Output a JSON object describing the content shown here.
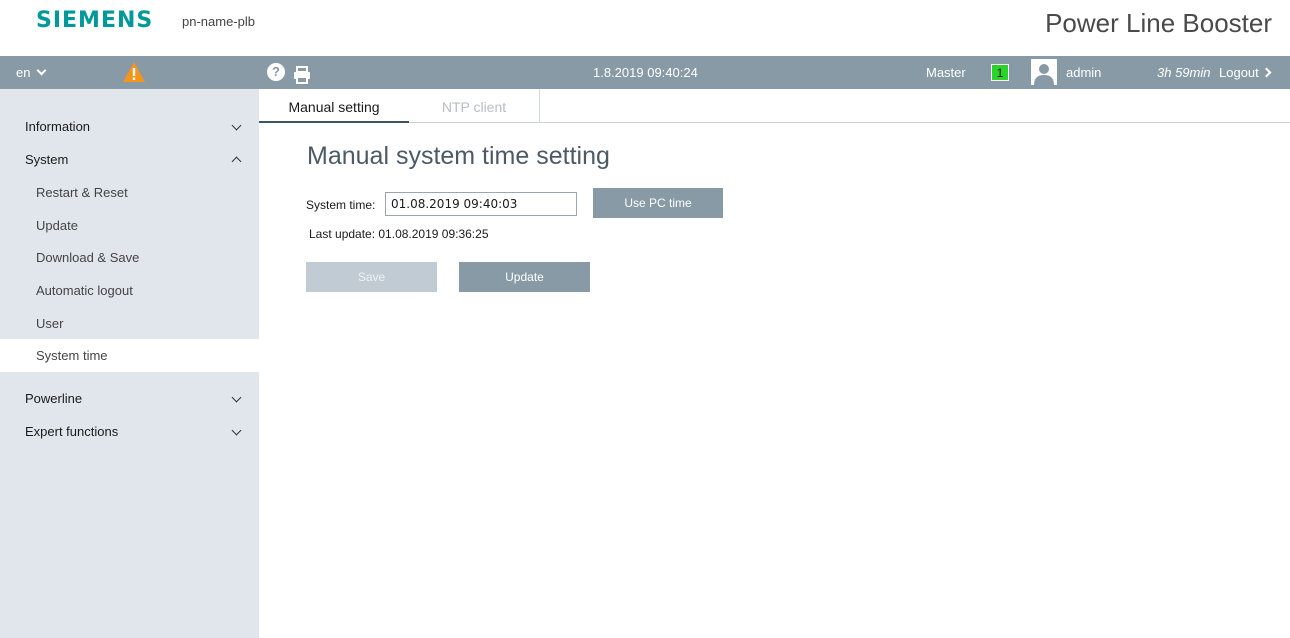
{
  "header": {
    "logo": "SIEMENS",
    "device_name": "pn-name-plb",
    "product_title": "Power Line Booster"
  },
  "toolbar": {
    "language": "en",
    "warning_icon": "warning-triangle-icon",
    "help_icon": "help-icon",
    "print_icon": "print-icon",
    "datetime": "1.8.2019 09:40:24",
    "role_label": "Master",
    "role_badge": "1",
    "user_icon": "user-icon",
    "username": "admin",
    "session_time": "3h 59min",
    "logout_label": "Logout"
  },
  "sidebar": {
    "items": [
      {
        "label": "Information",
        "expanded": false
      },
      {
        "label": "System",
        "expanded": true,
        "children": [
          "Restart & Reset",
          "Update",
          "Download & Save",
          "Automatic logout",
          "User",
          "System time"
        ],
        "active_child": "System time"
      },
      {
        "label": "Powerline",
        "expanded": false
      },
      {
        "label": "Expert functions",
        "expanded": false
      }
    ]
  },
  "tabs": [
    {
      "label": "Manual setting",
      "active": true
    },
    {
      "label": "NTP client",
      "active": false
    }
  ],
  "main": {
    "title": "Manual system time setting",
    "system_time_label": "System time:",
    "system_time_value": "01.08.2019 09:40:03",
    "use_pc_time_label": "Use PC time",
    "last_update_label": "Last update: 01.08.2019 09:36:25",
    "save_label": "Save",
    "update_label": "Update"
  },
  "colors": {
    "brand": "#009999",
    "toolbar_bg": "#879aa5",
    "sidebar_bg": "#e1e6ec",
    "role_badge": "#2bd428"
  }
}
